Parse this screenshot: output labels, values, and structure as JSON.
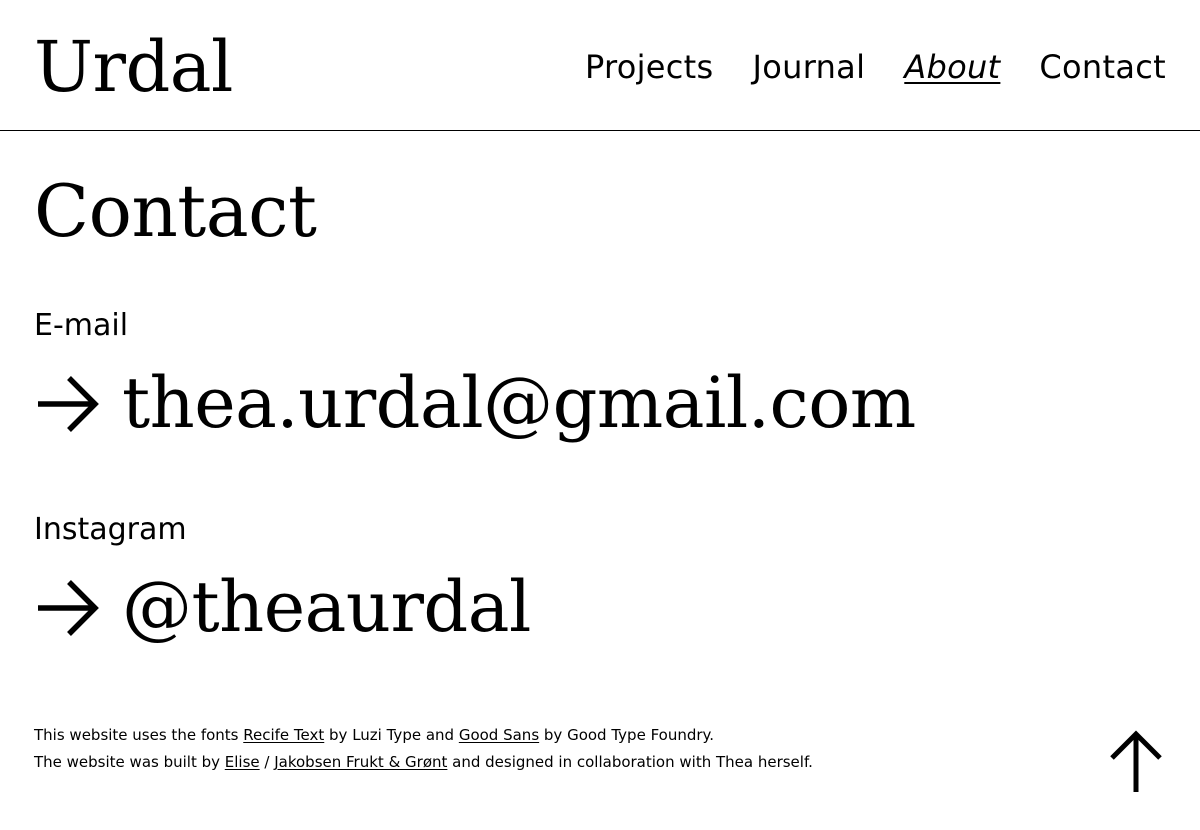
{
  "header": {
    "logo": "Urdal",
    "nav": [
      {
        "label": "Projects",
        "active": false
      },
      {
        "label": "Journal",
        "active": false
      },
      {
        "label": "About",
        "active": true
      },
      {
        "label": "Contact",
        "active": false
      }
    ]
  },
  "main": {
    "title": "Contact",
    "email": {
      "label": "E-mail",
      "value": "thea.urdal@gmail.com",
      "icon": "arrow-right-icon"
    },
    "instagram": {
      "label": "Instagram",
      "value": "@theaurdal",
      "icon": "arrow-right-icon"
    }
  },
  "footer": {
    "line1": {
      "prefix": "This website uses the fonts ",
      "font1": "Recife Text",
      "mid1": " by Luzi Type and ",
      "font2": "Good Sans",
      "suffix": " by Good Type Foundry."
    },
    "line2": {
      "prefix": "The website was built by ",
      "builder1": "Elise",
      "sep": " / ",
      "builder2": "Jakobsen Frukt & Grønt",
      "suffix": " and designed in collaboration with Thea herself."
    },
    "back_to_top_icon": "arrow-up-icon"
  },
  "colors": {
    "background": "#ffffff",
    "text": "#000000"
  }
}
